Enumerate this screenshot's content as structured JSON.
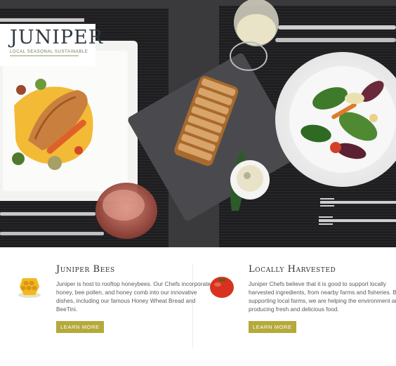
{
  "brand": {
    "logo_text": "JUNIPER",
    "tagline": "LOCAL   SEASONAL   SUSTAINABLE"
  },
  "hero": {
    "icon": "plated-dishes-photo"
  },
  "features": [
    {
      "title": "Juniper Bees",
      "body": "Juniper is host to rooftop honeybees. Our Chefs incorporate honey, bee pollen, and honey comb into our innovative dishes, including our famous Honey Wheat Bread and BeeTini.",
      "button_label": "LEARN MORE",
      "icon": "honeycomb-icon"
    },
    {
      "title": "Locally Harvested",
      "body": "Juniper Chefs believe that it is good to support locally harvested ingredients, from nearby farms and fisheries. By supporting local farms, we are helping the environment and producing fresh and delicious food.",
      "button_label": "LEARN MORE",
      "icon": "tomato-icon"
    }
  ],
  "colors": {
    "accent": "#b5a93b",
    "heading": "#2f2f2f",
    "body_text": "#5a5a5a",
    "logo": "#2f3a40"
  }
}
